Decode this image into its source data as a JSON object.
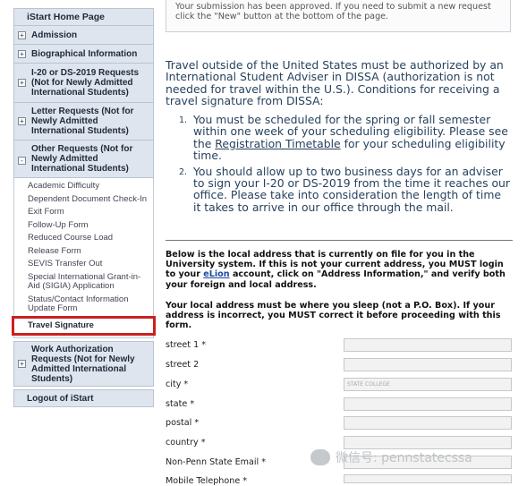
{
  "sidebar": {
    "home": "iStart Home Page",
    "sections": [
      {
        "label": "Admission",
        "toggle": "+"
      },
      {
        "label": "Biographical Information",
        "toggle": "+"
      },
      {
        "label": "I-20 or DS-2019 Requests (Not for Newly Admitted International Students)",
        "toggle": "+"
      },
      {
        "label": "Letter Requests (Not for Newly Admitted International Students)",
        "toggle": "+"
      },
      {
        "label": "Other Requests (Not for Newly Admitted International Students)",
        "toggle": "-"
      }
    ],
    "other_items": [
      "Academic Difficulty",
      "Dependent Document Check-In",
      "Exit Form",
      "Follow-Up Form",
      "Reduced Course Load",
      "Release Form",
      "SEVIS Transfer Out",
      "Special International Grant-in-Aid (SIGIA) Application",
      "Status/Contact Information Update Form",
      "Travel Signature"
    ],
    "work_auth": {
      "label": "Work Authorization Requests (Not for Newly Admitted International Students)",
      "toggle": "+"
    },
    "logout": "Logout of iStart"
  },
  "notice": "Your submission has been approved. If you need to submit a new request click the \"New\" button at the bottom of the page.",
  "intro": "Travel outside of the United States must be authorized by an International Student Adviser in DISSA (authorization is not needed for travel within the U.S.). Conditions for receiving a travel signature from DISSA:",
  "conditions": {
    "one_num": "1.",
    "one_a": "You must be scheduled for the spring or fall semester within one week of your scheduling eligibility. Please see the ",
    "one_link": "Registration Timetable",
    "one_b": " for your scheduling eligibility time.",
    "two_num": "2.",
    "two": "You should allow up to two business days for an adviser to sign your I-20 or DS-2019 from the time it reaches our office. Please take into consideration the length of time it takes to arrive in our office through the mail."
  },
  "address_info": {
    "a": "Below is the local address that is currently on file for you in the University system. If this is not your current address, you MUST login to your ",
    "link": "eLion",
    "b": " account, click on \"Address Information,\" and verify both your foreign and local address."
  },
  "address_warning": "Your local address must be where you sleep (not a P.O. Box). If your address is incorrect, you MUST correct it before proceeding with this form.",
  "fields": [
    {
      "label": "street 1 *",
      "value": ""
    },
    {
      "label": "street 2",
      "value": ""
    },
    {
      "label": "city *",
      "value": "STATE COLLEGE"
    },
    {
      "label": "state *",
      "value": ""
    },
    {
      "label": "postal *",
      "value": ""
    },
    {
      "label": "country *",
      "value": ""
    },
    {
      "label": "Non-Penn State Email *",
      "value": ""
    },
    {
      "label": "Mobile Telephone *",
      "value": ""
    }
  ],
  "watermark": "微信号: pennstatecssa"
}
